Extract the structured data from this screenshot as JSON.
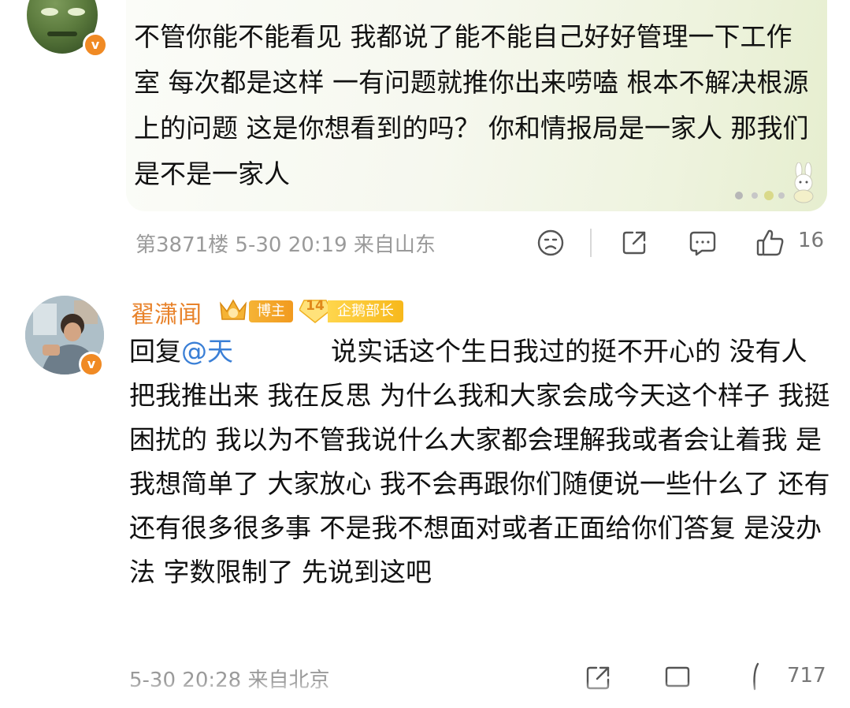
{
  "comment_top": {
    "text": "不管你能不能看见 我都说了能不能自己好好管理一下工作室 每次都是这样 一有问题就推你出来唠嗑 根本不解决根源上的问题 这是你想看到的吗？ 你和情报局是一家人 那我们是不是一家人",
    "meta": "第3871楼 5-30 20:19 来自山东",
    "like_count": "16",
    "icons": [
      "dislike-icon",
      "share-icon",
      "comment-icon",
      "like-icon"
    ]
  },
  "comment_reply": {
    "username": "翟潇闻",
    "blogger_tag": "博主",
    "level_number": "14",
    "level_tag": "企鹅部长",
    "reply_prefix": "回复",
    "mention": "@天",
    "text": "说实话这个生日我过的挺不开心的 没有人把我推出来 我在反思 为什么我和大家会成今天这个样子 我挺困扰的 我以为不管我说什么大家都会理解我或者会让着我 是我想简单了 大家放心 我不会再跟你们随便说一些什么了 还有还有很多很多事 不是我不想面对或者正面给你们答复 是没办法 字数限制了 先说到这吧",
    "meta": "5-30 20:28 来自北京",
    "like_count": "717",
    "username_color": "#e8822a",
    "mention_color": "#3a7fd6"
  },
  "verified_badge_glyph": "v"
}
